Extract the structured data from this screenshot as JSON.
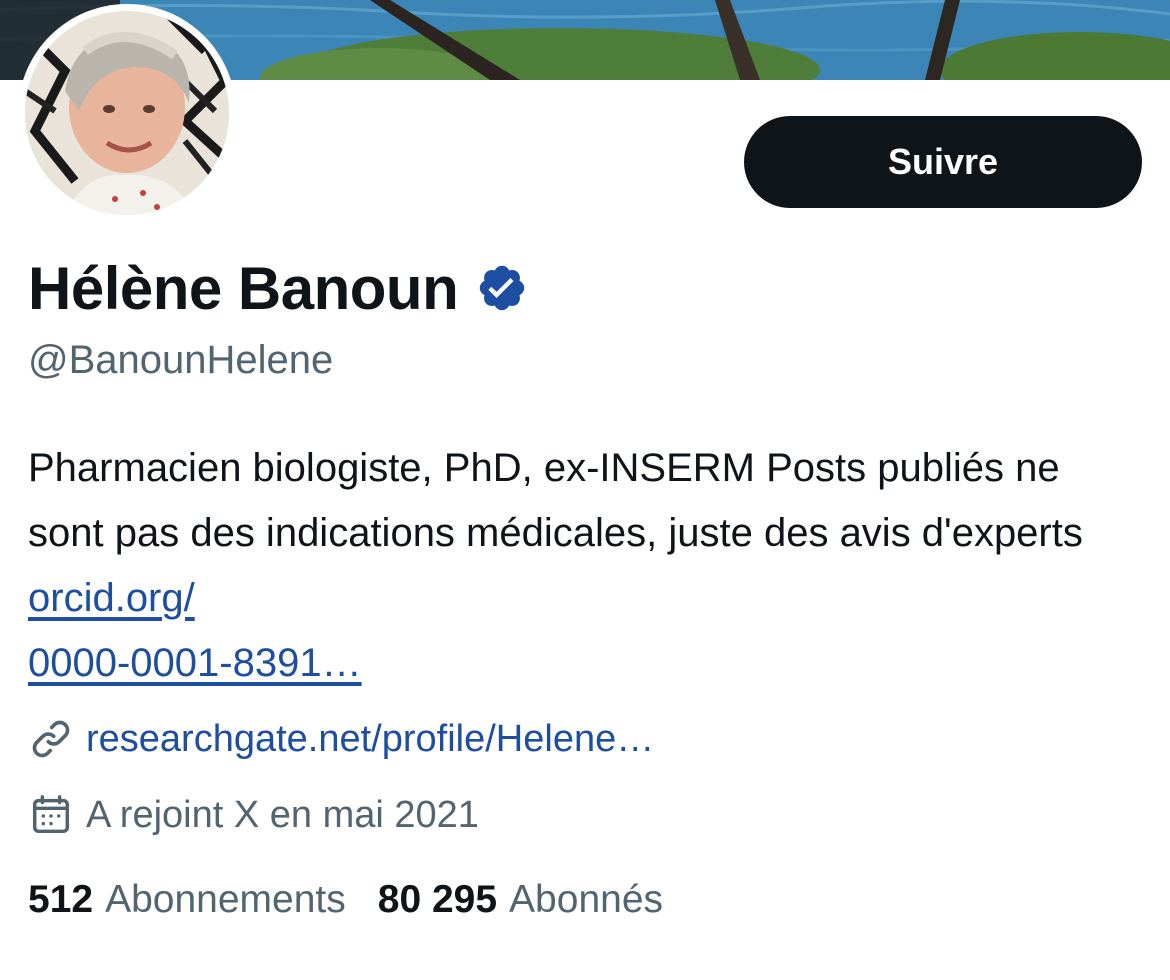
{
  "profile": {
    "display_name": "Hélène Banoun",
    "handle": "@BanounHelene",
    "verified_icon": "verified-badge-icon",
    "follow_label": "Suivre",
    "bio": {
      "text": "Pharmacien biologiste, PhD, ex-INSERM Posts publiés ne sont pas des indications médicales, juste des avis d'experts ",
      "link_line1": "orcid.org/",
      "link_line2": "0000-0001-8391…"
    },
    "website": "researchgate.net/profile/Helene…",
    "joined": "A rejoint X en mai 2021",
    "stats": {
      "following_count": "512",
      "following_label": "Abonnements",
      "followers_count": "80 295",
      "followers_label": "Abonnés"
    }
  },
  "colors": {
    "primary_text": "#0f1419",
    "secondary_text": "#536471",
    "link": "#1d4ea1",
    "verified": "#1d4ea1",
    "button_bg": "#0f1419"
  }
}
